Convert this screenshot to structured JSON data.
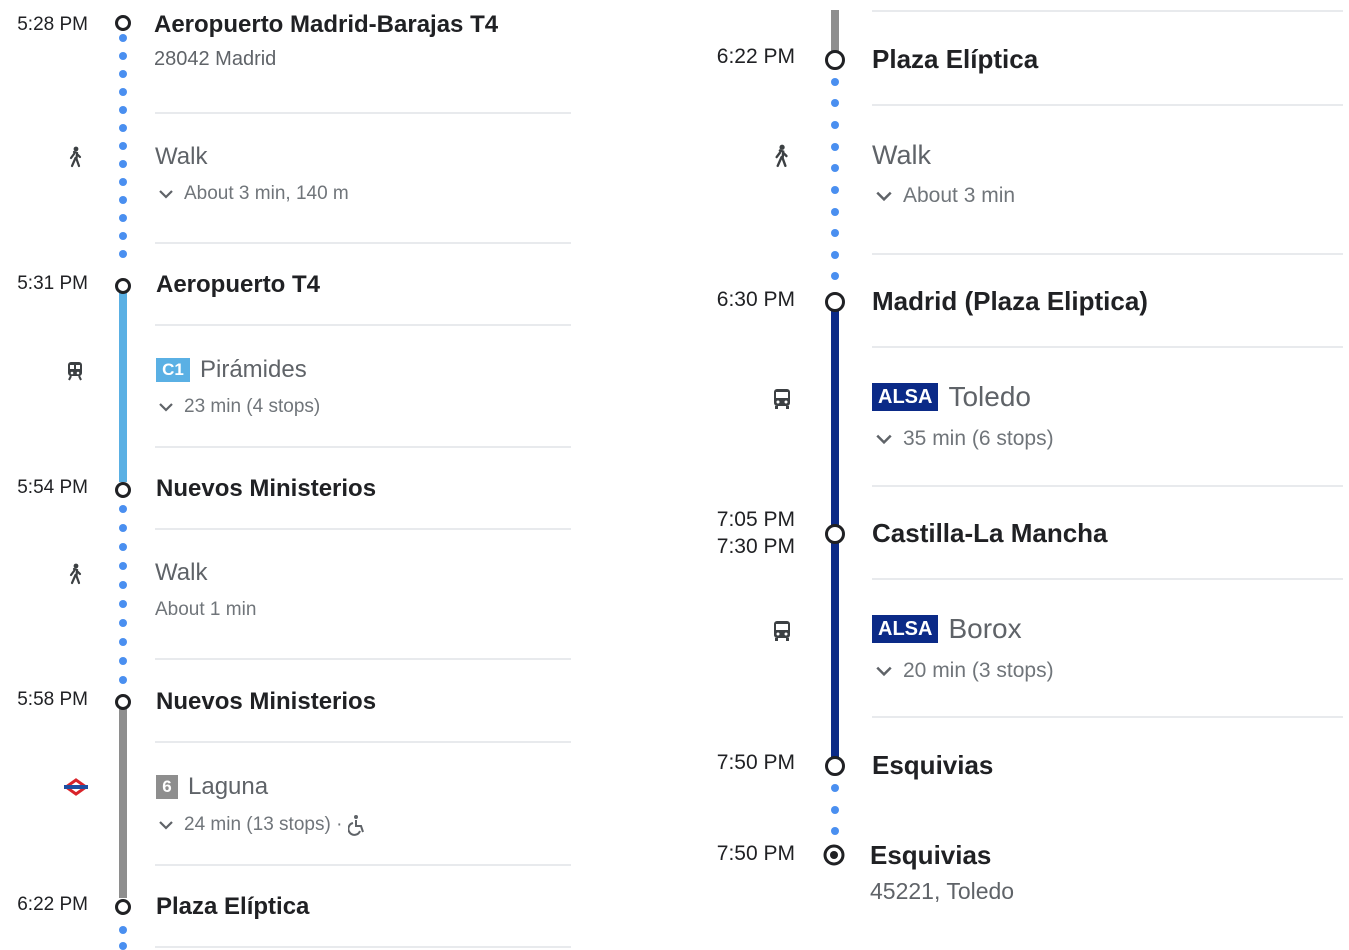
{
  "colors": {
    "walk_dot": "#4a8ff0",
    "c1_line": "#5ab0e4",
    "metro_line": "#8e8e8e",
    "bus_line": "#0b2a87",
    "alsa_badge": "#0b2a87",
    "c1_badge": "#5ab0e4",
    "metro_badge": "#8e8e8e",
    "metro_logo_red": "#d9232a",
    "metro_logo_blue": "#1e4ea1"
  },
  "left_column": {
    "stop1": {
      "time": "5:28 PM",
      "name": "Aeropuerto Madrid-Barajas T4",
      "address": "28042 Madrid"
    },
    "walk1": {
      "label": "Walk",
      "detail": "About 3 min, 140 m",
      "icon": "walk-icon"
    },
    "stop2": {
      "time": "5:31 PM",
      "name": "Aeropuerto T4"
    },
    "train1": {
      "badge": "C1",
      "destination": "Pirámides",
      "detail": "23 min (4 stops)",
      "icon": "train-icon"
    },
    "stop3": {
      "time": "5:54 PM",
      "name": "Nuevos Ministerios"
    },
    "walk2": {
      "label": "Walk",
      "detail": "About 1 min",
      "icon": "walk-icon"
    },
    "stop4": {
      "time": "5:58 PM",
      "name": "Nuevos Ministerios"
    },
    "metro1": {
      "badge": "6",
      "destination": "Laguna",
      "detail": "24 min (13 stops) ·",
      "icon": "metro-icon",
      "accessibility_icon": "wheelchair-icon"
    },
    "stop5": {
      "time": "6:22 PM",
      "name": "Plaza Elíptica"
    }
  },
  "right_column": {
    "stop1": {
      "time": "6:22 PM",
      "name": "Plaza Elíptica"
    },
    "walk1": {
      "label": "Walk",
      "detail": "About 3 min",
      "icon": "walk-icon"
    },
    "stop2": {
      "time": "6:30 PM",
      "name": "Madrid (Plaza Eliptica)"
    },
    "bus1": {
      "badge": "ALSA",
      "destination": "Toledo",
      "detail": "35 min (6 stops)",
      "icon": "bus-icon"
    },
    "stop3": {
      "time_arrive": "7:05 PM",
      "time_depart": "7:30 PM",
      "name": "Castilla-La Mancha"
    },
    "bus2": {
      "badge": "ALSA",
      "destination": "Borox",
      "detail": "20 min (3 stops)",
      "icon": "bus-icon"
    },
    "stop4": {
      "time": "7:50 PM",
      "name": "Esquivias"
    },
    "stop5": {
      "time": "7:50 PM",
      "name": "Esquivias",
      "address": "45221, Toledo"
    }
  }
}
